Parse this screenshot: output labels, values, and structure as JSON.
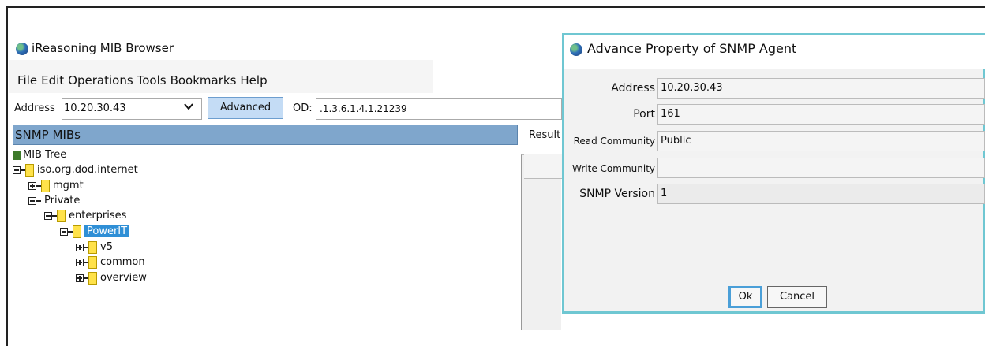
{
  "main_window": {
    "title": "iReasoning MIB Browser",
    "menu": [
      "File",
      "Edit",
      "Operations",
      "Tools",
      "Bookmarks",
      "Help"
    ],
    "toolbar": {
      "address_label": "Address",
      "address_value": "10.20.30.43",
      "advanced_label": "Advanced",
      "oid_label": "OD:",
      "oid_value": ".1.3.6.1.4.1.21239"
    },
    "snmp_mibs_label": "SNMP MIBs",
    "result_label": "Result",
    "tree": {
      "root": "MIB Tree",
      "nodes": [
        "iso.org.dod.internet",
        "mgmt",
        "Private",
        "enterprises",
        "PowerIT",
        "v5",
        "common",
        "overview"
      ],
      "selected": "PowerIT"
    }
  },
  "dialog": {
    "title": "Advance Property of SNMP Agent",
    "fields": [
      {
        "label": "Address",
        "value": "10.20.30.43"
      },
      {
        "label": "Port",
        "value": "161"
      },
      {
        "label": "Read Community",
        "value": "Public"
      },
      {
        "label": "Write Community",
        "value": ""
      },
      {
        "label": "SNMP Version",
        "value": "1"
      }
    ],
    "ok_label": "Ok",
    "cancel_label": "Cancel"
  },
  "colors": {
    "header_blue": "#7fa6cc",
    "advanced_button": "#c4dcf5",
    "selection": "#2f8fd6",
    "dialog_border": "#6fc7d2",
    "folder_yellow": "#ffe24a"
  }
}
